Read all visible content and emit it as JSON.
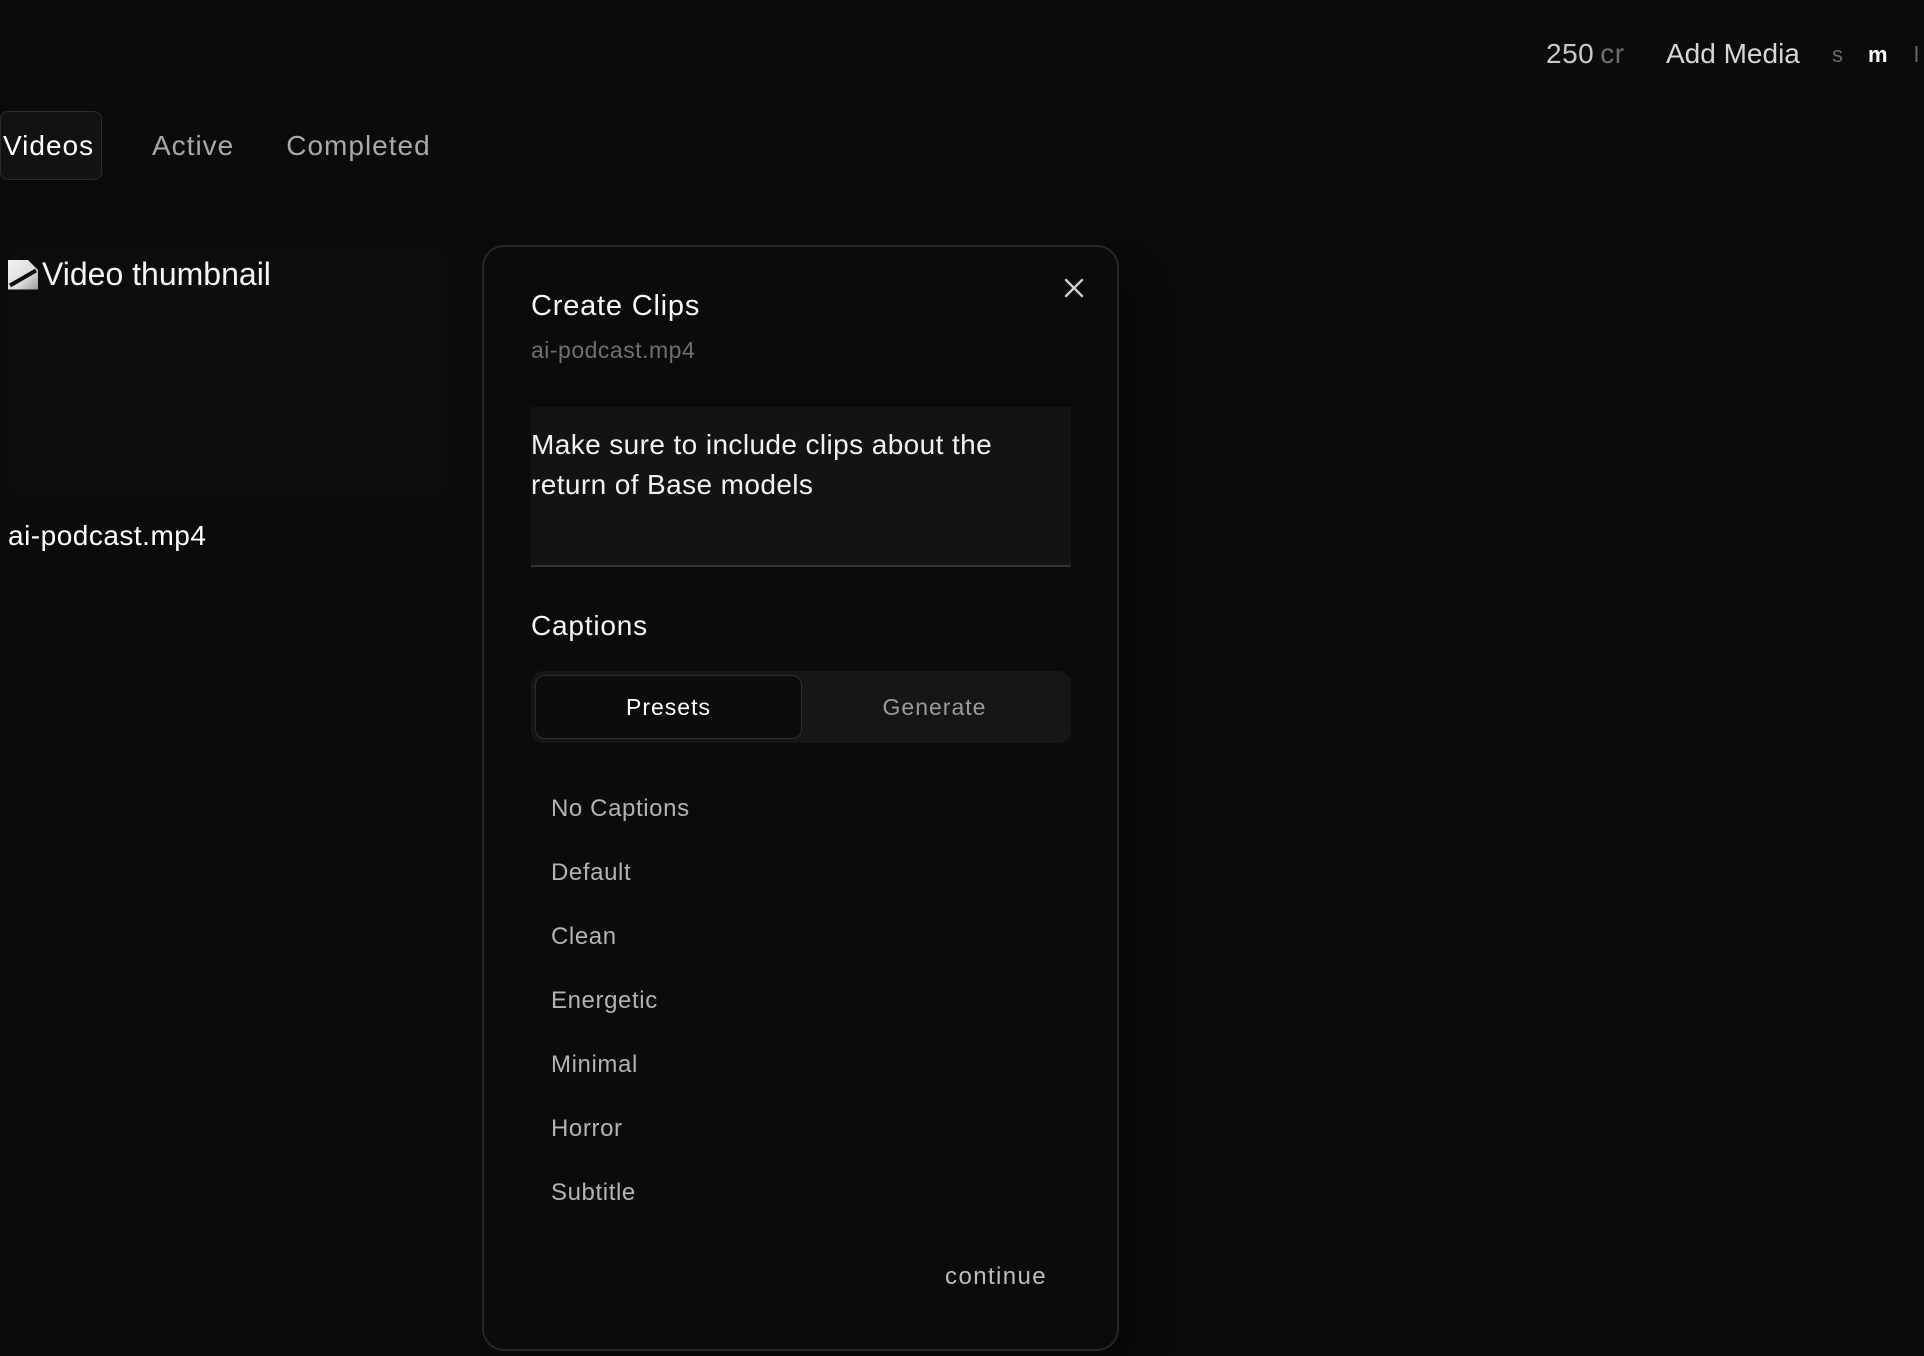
{
  "header": {
    "credits_value": "250",
    "credits_unit": "cr",
    "add_media_label": "Add Media",
    "size_options": [
      "s",
      "m",
      "l"
    ],
    "selected_size": "m"
  },
  "tabs": [
    {
      "label": "Videos",
      "active": true
    },
    {
      "label": "Active",
      "active": false
    },
    {
      "label": "Completed",
      "active": false
    }
  ],
  "video_card": {
    "thumbnail_alt": "Video thumbnail",
    "title": "ai-podcast.mp4"
  },
  "modal": {
    "title": "Create Clips",
    "subtitle": "ai-podcast.mp4",
    "prompt_value": "Make sure to include clips about the return of Base models",
    "captions_label": "Captions",
    "caption_modes": [
      {
        "label": "Presets",
        "active": true
      },
      {
        "label": "Generate",
        "active": false
      }
    ],
    "caption_presets": [
      "No Captions",
      "Default",
      "Clean",
      "Energetic",
      "Minimal",
      "Horror",
      "Subtitle"
    ],
    "continue_label": "continue"
  },
  "icons": {
    "close": "close-icon",
    "broken_image": "broken-image-icon"
  },
  "colors": {
    "background": "#0b0b0b",
    "modal_border": "#262626",
    "muted_text": "#6f6f6f",
    "accent_text": "#ffffff"
  }
}
